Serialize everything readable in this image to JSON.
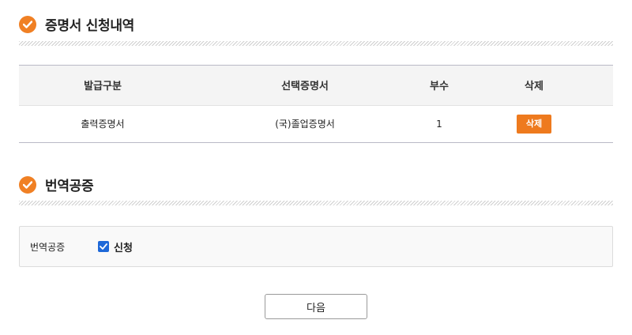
{
  "section1": {
    "title": "증명서 신청내역",
    "icon": "check-circle-icon"
  },
  "table": {
    "headers": [
      "발급구분",
      "선택증명서",
      "부수",
      "삭제"
    ],
    "rows": [
      {
        "type": "출력증명서",
        "certificate": "(국)졸업증명서",
        "copies": "1",
        "delete_label": "삭제"
      }
    ]
  },
  "section2": {
    "title": "번역공증",
    "icon": "check-circle-icon"
  },
  "translation": {
    "label": "번역공증",
    "checkbox_label": "신청",
    "checked": true
  },
  "next_button": {
    "label": "다음"
  },
  "colors": {
    "accent": "#f08024",
    "checkbox": "#1e68d8"
  }
}
